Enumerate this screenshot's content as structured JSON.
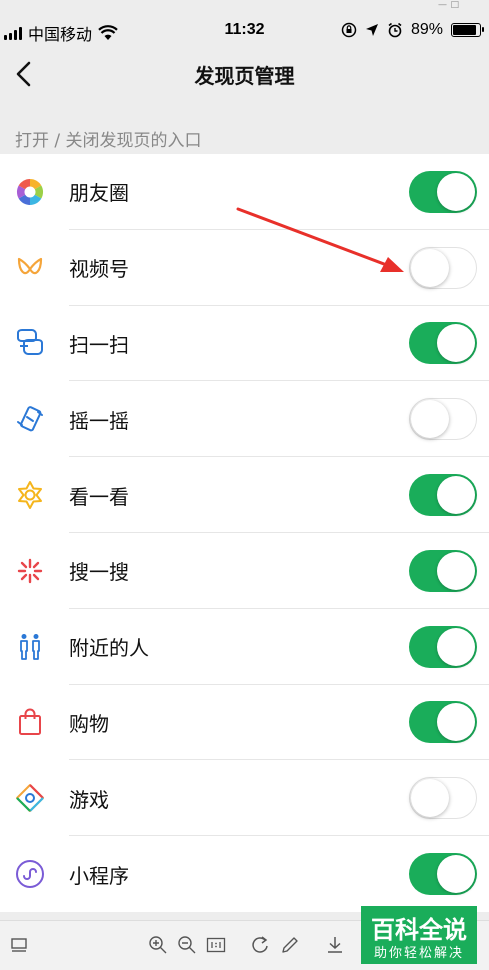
{
  "status": {
    "carrier": "中国移动",
    "time": "11:32",
    "battery": "89%",
    "battery_level": 0.89
  },
  "nav": {
    "title": "发现页管理"
  },
  "section": {
    "label": "打开 / 关闭发现页的入口"
  },
  "items": [
    {
      "label": "朋友圈",
      "icon": "moments-icon",
      "enabled": true
    },
    {
      "label": "视频号",
      "icon": "channels-icon",
      "enabled": false
    },
    {
      "label": "扫一扫",
      "icon": "scan-icon",
      "enabled": true
    },
    {
      "label": "摇一摇",
      "icon": "shake-icon",
      "enabled": false
    },
    {
      "label": "看一看",
      "icon": "top-stories-icon",
      "enabled": true
    },
    {
      "label": "搜一搜",
      "icon": "search-icon",
      "enabled": true
    },
    {
      "label": "附近的人",
      "icon": "people-nearby-icon",
      "enabled": true
    },
    {
      "label": "购物",
      "icon": "shopping-bag-icon",
      "enabled": true
    },
    {
      "label": "游戏",
      "icon": "games-icon",
      "enabled": false
    },
    {
      "label": "小程序",
      "icon": "mini-programs-icon",
      "enabled": true
    }
  ],
  "watermark": {
    "title": "百科全说",
    "subtitle": "助你轻松解决"
  },
  "colors": {
    "toggle_on": "#1aad5a",
    "arrow": "#e8302a"
  }
}
